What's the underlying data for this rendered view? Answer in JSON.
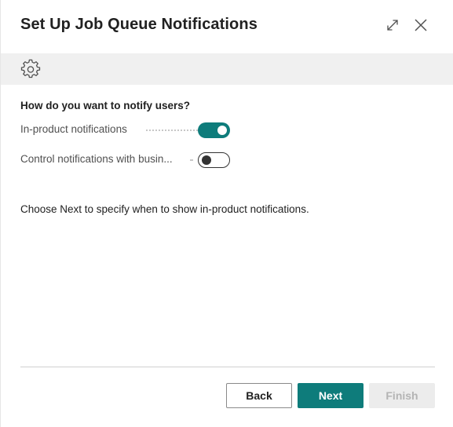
{
  "dialog": {
    "title": "Set Up Job Queue Notifications",
    "header_icons": [
      "expand-icon",
      "close-icon"
    ]
  },
  "actionbar": {
    "icon": "gear-icon"
  },
  "content": {
    "question": "How do you want to notify users?",
    "fields": [
      {
        "label": "In-product notifications",
        "enabled": true
      },
      {
        "label": "Control notifications with busin...",
        "enabled": false
      }
    ],
    "info": "Choose Next to specify when to show in-product notifications."
  },
  "footer": {
    "back_label": "Back",
    "next_label": "Next",
    "finish_label": "Finish"
  },
  "colors": {
    "accent": "#0e7c7b",
    "actionbar_bg": "#f0f0f0",
    "disabled_bg": "#ececec"
  }
}
